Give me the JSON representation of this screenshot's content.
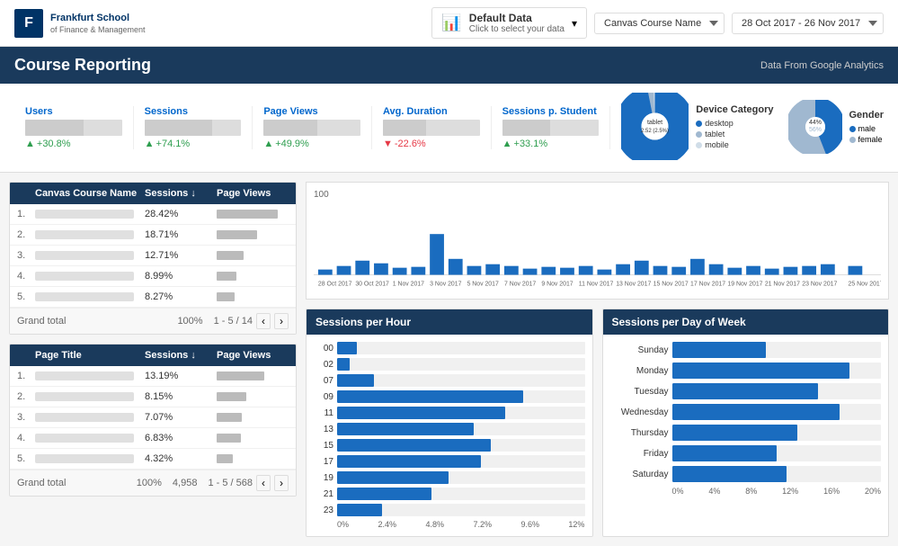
{
  "header": {
    "logo_text": "Frankfurt School",
    "logo_sub": "of Finance & Management",
    "logo_char": "F",
    "data_selector_title": "Default Data",
    "data_selector_sub": "Click to select your data",
    "course_dropdown_value": "Canvas Course Name",
    "date_range_value": "28 Oct 2017 - 26 Nov 2017"
  },
  "page": {
    "title": "Course Reporting",
    "subtitle": "Data From Google Analytics"
  },
  "stats": [
    {
      "label": "Users",
      "change": "+30.8%",
      "direction": "up"
    },
    {
      "label": "Sessions",
      "change": "+74.1%",
      "direction": "up"
    },
    {
      "label": "Page Views",
      "change": "+49.9%",
      "direction": "up"
    },
    {
      "label": "Avg. Duration",
      "change": "-22.6%",
      "direction": "down"
    },
    {
      "label": "Sessions p. Student",
      "change": "+33.1%",
      "direction": "up"
    }
  ],
  "device_category": {
    "title": "Device Category",
    "items": [
      {
        "label": "desktop",
        "color": "#1a6cbf",
        "percent": 96.8
      },
      {
        "label": "tablet",
        "color": "#a0b8d0",
        "percent": 2.52
      },
      {
        "label": "mobile",
        "color": "#d0dde8",
        "percent": 0.68
      }
    ],
    "center_label": "tablet",
    "center_value": "2.52 (2.5%)"
  },
  "gender": {
    "title": "Gender",
    "male_pct": 44,
    "female_pct": 56,
    "male_label": "male",
    "female_label": "female",
    "male_color": "#1a6cbf",
    "female_color": "#a0b8d0"
  },
  "course_table": {
    "title_col": "Canvas Course Name",
    "sessions_col": "Sessions ↓",
    "pageviews_col": "Page Views",
    "rows": [
      {
        "num": "1.",
        "sessions": "28.42%",
        "bar_pct": 85
      },
      {
        "num": "2.",
        "sessions": "18.71%",
        "bar_pct": 56
      },
      {
        "num": "3.",
        "sessions": "12.71%",
        "bar_pct": 38
      },
      {
        "num": "4.",
        "sessions": "8.99%",
        "bar_pct": 27
      },
      {
        "num": "5.",
        "sessions": "8.27%",
        "bar_pct": 25
      }
    ],
    "footer_label": "Grand total",
    "footer_sessions": "100%",
    "pagination": "1 - 5 / 14"
  },
  "page_table": {
    "title_col": "Page Title",
    "sessions_col": "Sessions ↓",
    "pageviews_col": "Page Views",
    "rows": [
      {
        "num": "1.",
        "sessions": "13.19%",
        "bar_pct": 66
      },
      {
        "num": "2.",
        "sessions": "8.15%",
        "bar_pct": 41
      },
      {
        "num": "3.",
        "sessions": "7.07%",
        "bar_pct": 35
      },
      {
        "num": "4.",
        "sessions": "6.83%",
        "bar_pct": 34
      },
      {
        "num": "5.",
        "sessions": "4.32%",
        "bar_pct": 22
      }
    ],
    "footer_label": "Grand total",
    "footer_sessions": "100%",
    "footer_pageviews": "4,958",
    "pagination": "1 - 5 / 568"
  },
  "timeline": {
    "y_max": "100",
    "dates": [
      "28 Oct 2017",
      "30 Oct 2017",
      "1 Nov 2017",
      "3 Nov 2017",
      "5 Nov 2017",
      "7 Nov 2017",
      "9 Nov 2017",
      "11 Nov 2017",
      "13 Nov 2017",
      "15 Nov 2017",
      "17 Nov 2017",
      "19 Nov 2017",
      "21 Nov 2017",
      "23 Nov 2017",
      "25 Nov 2017"
    ],
    "bars": [
      5,
      8,
      12,
      10,
      7,
      9,
      45,
      15,
      8,
      10,
      8,
      6,
      9,
      7,
      8,
      5,
      10,
      12,
      8,
      9,
      15,
      10,
      7,
      8,
      6,
      9,
      8,
      10
    ]
  },
  "sessions_per_hour": {
    "title": "Sessions per Hour",
    "hours": [
      "00",
      "02",
      "07",
      "09",
      "11",
      "13",
      "15",
      "17",
      "19",
      "21",
      "23"
    ],
    "values": [
      8,
      5,
      15,
      75,
      68,
      55,
      62,
      58,
      45,
      38,
      18
    ],
    "axis_labels": [
      "0%",
      "2.4%",
      "4.8%",
      "7.2%",
      "9.6%",
      "12%"
    ]
  },
  "sessions_per_dow": {
    "title": "Sessions per Day of Week",
    "days": [
      "Sunday",
      "Monday",
      "Tuesday",
      "Wednesday",
      "Thursday",
      "Friday",
      "Saturday"
    ],
    "values": [
      45,
      85,
      70,
      80,
      60,
      50,
      55
    ],
    "axis_labels": [
      "0%",
      "4%",
      "8%",
      "12%",
      "16%",
      "20%"
    ]
  }
}
